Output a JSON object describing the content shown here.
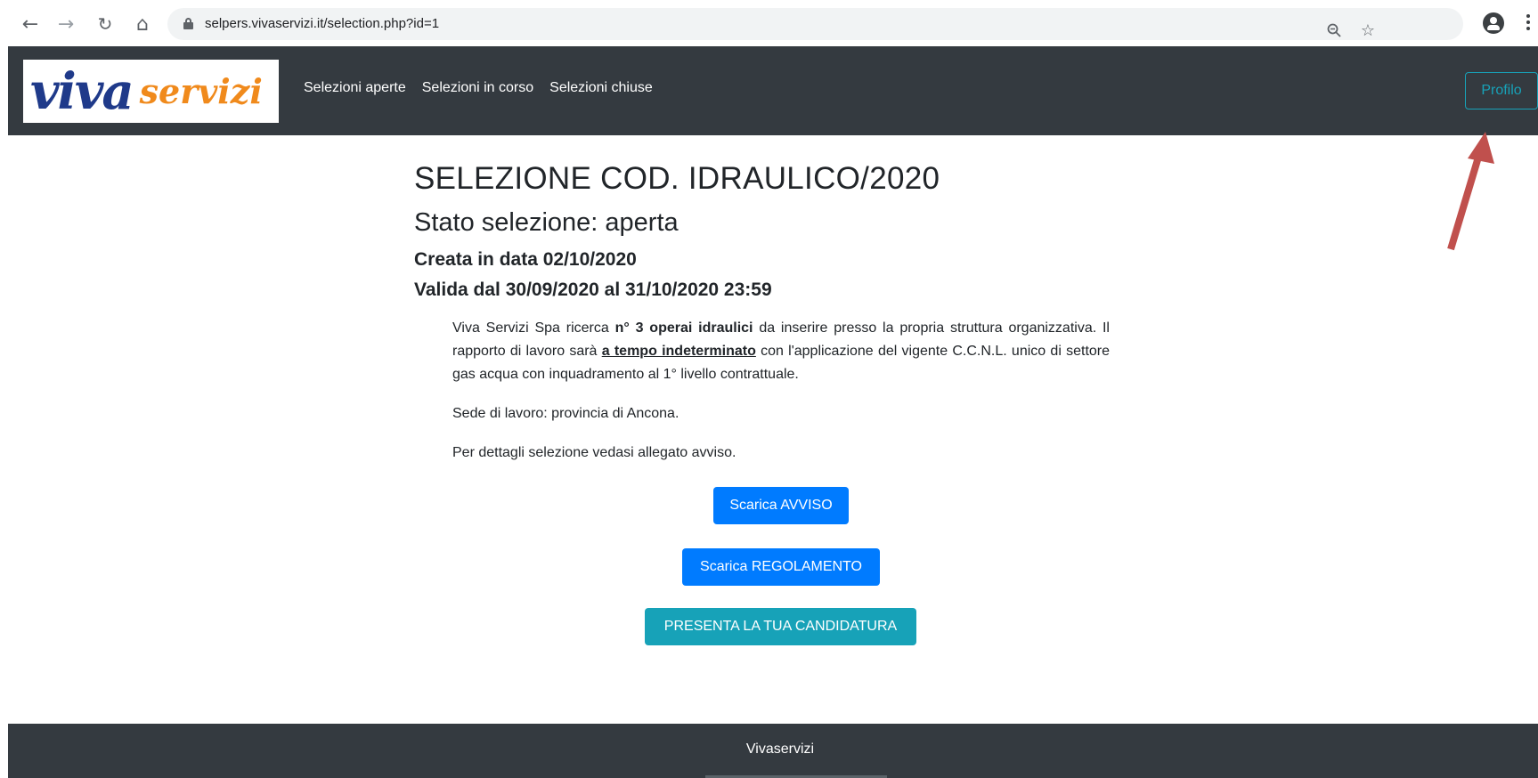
{
  "browser": {
    "url": "selpers.vivaservizi.it/selection.php?id=1",
    "icons": {
      "back": "arrow-left-icon",
      "forward": "arrow-right-icon",
      "reload": "reload-icon",
      "home": "home-icon",
      "lock": "lock-icon",
      "zoom": "zoom-out-icon",
      "bookmark": "star-icon",
      "account": "account-icon",
      "menu": "kebab-menu-icon"
    }
  },
  "navbar": {
    "logo_primary": "viva",
    "logo_secondary": "servizi",
    "links": [
      "Selezioni aperte",
      "Selezioni in corso",
      "Selezioni chiuse"
    ],
    "profile_label": "Profilo"
  },
  "main": {
    "title": "SELEZIONE COD. IDRAULICO/2020",
    "status": "Stato selezione: aperta",
    "created": "Creata in data 02/10/2020",
    "valid": "Valida dal 30/09/2020 al 31/10/2020 23:59",
    "description": {
      "p1_part1": "Viva Servizi Spa ricerca ",
      "p1_bold": "n° 3 operai idraulici",
      "p1_part2": " da inserire presso la propria struttura organizzativa. Il rapporto di lavoro sarà ",
      "p1_underline": "a tempo indeterminato",
      "p1_part3": " con l'applicazione del vigente C.C.N.L. unico di settore gas acqua con inquadramento al 1° livello contrattuale.",
      "p2": "Sede di lavoro: provincia di Ancona.",
      "p3": "Per dettagli selezione vedasi allegato avviso."
    },
    "buttons": {
      "avviso": "Scarica AVVISO",
      "regolamento": "Scarica REGOLAMENTO",
      "candidatura": "PRESENTA LA TUA CANDIDATURA"
    }
  },
  "footer": {
    "text": "Vivaservizi"
  },
  "colors": {
    "navbar_bg": "#343a40",
    "primary": "#007bff",
    "info": "#17a2b8",
    "logo_blue": "#1f3a8a",
    "logo_orange": "#f08a1c",
    "annotation_arrow": "#c0504d"
  }
}
